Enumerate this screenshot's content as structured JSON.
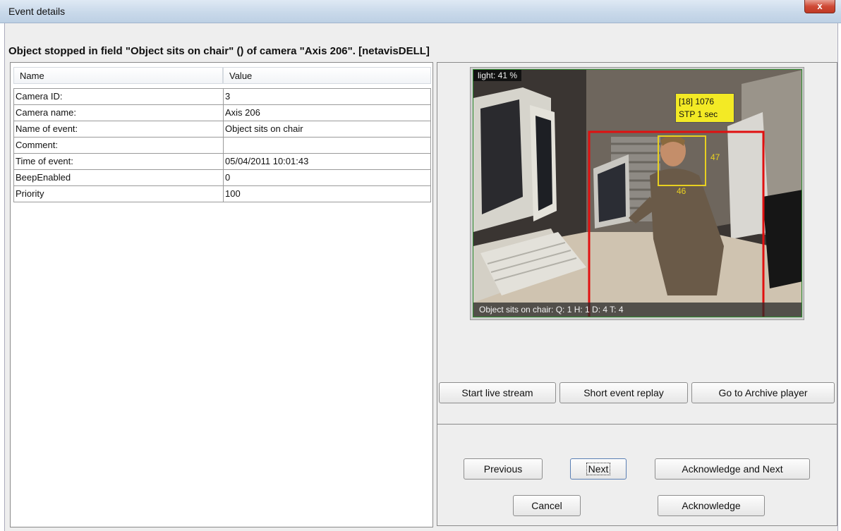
{
  "window": {
    "title": "Event details",
    "close_glyph": "x"
  },
  "headline": "Object stopped in field \"Object sits on chair\" () of camera \"Axis 206\". [netavisDELL]",
  "table": {
    "headers": [
      "Name",
      "Value"
    ],
    "rows": [
      {
        "name": "Camera ID:",
        "value": "3"
      },
      {
        "name": "Camera name:",
        "value": "Axis 206"
      },
      {
        "name": "Name of event:",
        "value": "Object sits on chair"
      },
      {
        "name": "Comment:",
        "value": ""
      },
      {
        "name": "Time of event:",
        "value": "05/04/2011 10:01:43"
      },
      {
        "name": "BeepEnabled",
        "value": "0"
      },
      {
        "name": "Priority",
        "value": "100"
      }
    ]
  },
  "video": {
    "light": "light: 41 %",
    "tag_line1": "[18] 1076",
    "tag_line2": "STP 1 sec",
    "label_47": "47",
    "label_46": "46",
    "status": "Object sits on chair:  Q: 1 H: 1 D: 4 T: 4"
  },
  "media_buttons": {
    "live": "Start live stream",
    "replay": "Short event replay",
    "archive": "Go to Archive player"
  },
  "nav_buttons": {
    "previous": "Previous",
    "next": "Next",
    "ack_next": "Acknowledge and Next",
    "cancel": "Cancel",
    "ack": "Acknowledge"
  },
  "colors": {
    "tracking_box": "#e01010",
    "face_box": "#e8d020",
    "tag_bg": "#f3ea25"
  }
}
